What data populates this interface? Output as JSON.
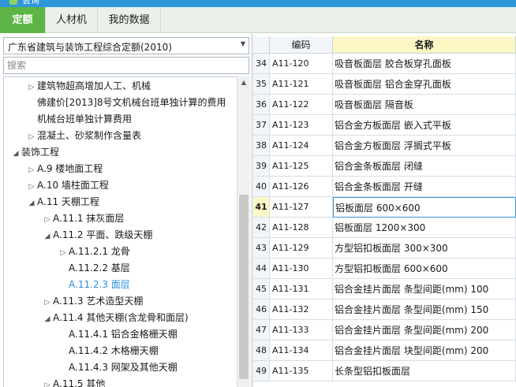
{
  "window": {
    "title": "会询"
  },
  "tabs": [
    {
      "label": "定额",
      "active": true
    },
    {
      "label": "人材机",
      "active": false
    },
    {
      "label": "我的数据",
      "active": false
    }
  ],
  "left": {
    "quota_select": "广东省建筑与装饰工程综合定额(2010)",
    "search_placeholder": "搜索",
    "tree": [
      {
        "label": "建筑物超高增加人工、机械",
        "level": 1,
        "arrow": "▷"
      },
      {
        "label": "佛建价[2013]8号文机械台班单独计算的费用",
        "level": 1,
        "arrow": ""
      },
      {
        "label": "机械台班单独计算费用",
        "level": 1,
        "arrow": ""
      },
      {
        "label": "混凝土、砂浆制作含量表",
        "level": 1,
        "arrow": "▷"
      },
      {
        "label": "装饰工程",
        "level": 0,
        "arrow": "◢"
      },
      {
        "label": "A.9 楼地面工程",
        "level": 1,
        "arrow": "▷"
      },
      {
        "label": "A.10 墙柱面工程",
        "level": 1,
        "arrow": "▷"
      },
      {
        "label": "A.11 天棚工程",
        "level": 1,
        "arrow": "◢"
      },
      {
        "label": "A.11.1 抹灰面层",
        "level": 2,
        "arrow": "▷"
      },
      {
        "label": "A.11.2 平面、跌级天棚",
        "level": 2,
        "arrow": "◢"
      },
      {
        "label": "A.11.2.1 龙骨",
        "level": 3,
        "arrow": "▷"
      },
      {
        "label": "A.11.2.2 基层",
        "level": 3,
        "arrow": ""
      },
      {
        "label": "A.11.2.3 面层",
        "level": 3,
        "arrow": "",
        "selected": true
      },
      {
        "label": "A.11.3 艺术造型天棚",
        "level": 2,
        "arrow": "▷"
      },
      {
        "label": "A.11.4 其他天棚(含龙骨和面层)",
        "level": 2,
        "arrow": "◢"
      },
      {
        "label": "A.11.4.1 铝合金格栅天棚",
        "level": 3,
        "arrow": ""
      },
      {
        "label": "A.11.4.2 木格栅天棚",
        "level": 3,
        "arrow": ""
      },
      {
        "label": "A.11.4.3 网架及其他天棚",
        "level": 3,
        "arrow": ""
      },
      {
        "label": "A.11.5 其他",
        "level": 2,
        "arrow": "▷"
      }
    ]
  },
  "grid": {
    "headers": {
      "num": "",
      "code": "编码",
      "name": "名称"
    },
    "rows": [
      {
        "num": "34",
        "code": "A11-120",
        "name": "吸音板面层 胶合板穿孔面板"
      },
      {
        "num": "35",
        "code": "A11-121",
        "name": "吸音板面层 铝合金穿孔面板"
      },
      {
        "num": "36",
        "code": "A11-122",
        "name": "吸音板面层 隔音板"
      },
      {
        "num": "37",
        "code": "A11-123",
        "name": "铝合金方板面层 嵌入式平板"
      },
      {
        "num": "38",
        "code": "A11-124",
        "name": "铝合金方板面层 浮搁式平板"
      },
      {
        "num": "39",
        "code": "A11-125",
        "name": "铝合金条板面层 闭缝"
      },
      {
        "num": "40",
        "code": "A11-126",
        "name": "铝合金条板面层 开缝"
      },
      {
        "num": "41",
        "code": "A11-127",
        "name": "铝板面层 600×600",
        "selected": true
      },
      {
        "num": "42",
        "code": "A11-128",
        "name": "铝板面层 1200×300"
      },
      {
        "num": "43",
        "code": "A11-129",
        "name": "方型铝扣板面层 300×300"
      },
      {
        "num": "44",
        "code": "A11-130",
        "name": "方型铝扣板面层 600×600"
      },
      {
        "num": "45",
        "code": "A11-131",
        "name": "铝合金挂片面层 条型间距(mm) 100"
      },
      {
        "num": "46",
        "code": "A11-132",
        "name": "铝合金挂片面层 条型间距(mm) 150"
      },
      {
        "num": "47",
        "code": "A11-133",
        "name": "铝合金挂片面层 条型间距(mm) 200"
      },
      {
        "num": "48",
        "code": "A11-134",
        "name": "铝合金挂片面层 块型间距(mm) 200"
      },
      {
        "num": "49",
        "code": "A11-135",
        "name": "长条型铝扣板面层"
      }
    ]
  },
  "colors": {
    "titlebar": "#2f97d9",
    "tab_active": "#5cb545",
    "selected_tree": "#2e8fe0",
    "name_header": "#fcf7c4"
  }
}
